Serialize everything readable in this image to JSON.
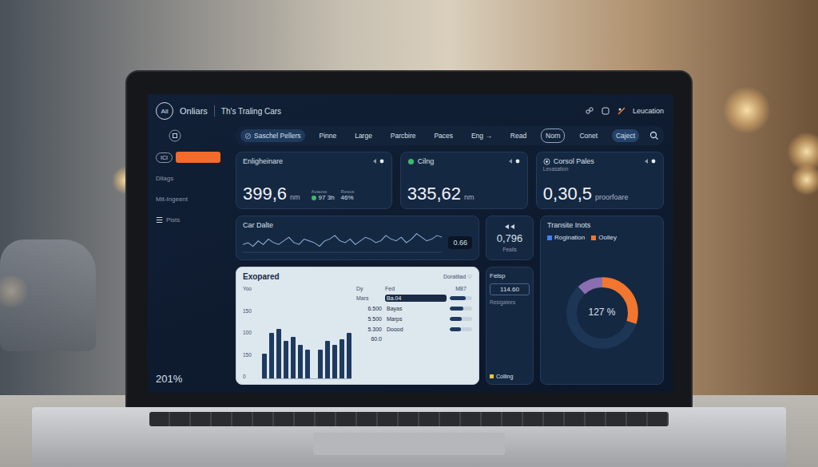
{
  "topbar": {
    "logo": "All",
    "app": "Onliars",
    "title": "Th's Traling Cars",
    "location": "Leucation"
  },
  "sidebar": {
    "items": [
      {
        "label": "ICI",
        "icon": "",
        "selected": true
      },
      {
        "label": "Dllags",
        "icon": "",
        "selected": false
      },
      {
        "label": "Mit-Ingeent",
        "icon": "",
        "selected": false
      },
      {
        "label": "Pists",
        "icon": "☰",
        "selected": false
      }
    ],
    "footer": "201%"
  },
  "filters": [
    {
      "label": "Saschel Pellers",
      "kind": "chip",
      "selected": true
    },
    {
      "label": "Pinne",
      "kind": "plain",
      "selected": false
    },
    {
      "label": "Large",
      "kind": "plain",
      "selected": false
    },
    {
      "label": "Parcbire",
      "kind": "plain",
      "selected": false
    },
    {
      "label": "Paces",
      "kind": "plain",
      "selected": false
    },
    {
      "label": "Eng →",
      "kind": "plain",
      "selected": false
    },
    {
      "label": "Read",
      "kind": "plain",
      "selected": false
    },
    {
      "label": "Norn",
      "kind": "outline",
      "selected": false
    },
    {
      "label": "Conet",
      "kind": "plain",
      "selected": false
    },
    {
      "label": "Caject",
      "kind": "filled",
      "selected": false
    }
  ],
  "cards": [
    {
      "title": "Enligheinare",
      "sub": "",
      "value": "399,6",
      "unit": "nm",
      "stats": [
        {
          "label": "Avaoss",
          "value": "97 3h",
          "kind": "dot"
        },
        {
          "label": "Resos",
          "value": "46%",
          "kind": "plain"
        }
      ]
    },
    {
      "title": "Cilng",
      "sub": "",
      "value": "335,62",
      "unit": "nm",
      "stats": []
    },
    {
      "title": "Corsol Pales",
      "sub": "Levasation",
      "value": "0,30,5",
      "unit": "proorfoare",
      "stats": []
    }
  ],
  "trend": {
    "title": "Car Dalte",
    "badge": "0.66",
    "values": [
      4,
      5,
      3,
      6,
      4,
      7,
      5,
      4,
      6,
      8,
      5,
      4,
      7,
      6,
      5,
      3,
      6,
      7,
      9,
      6,
      5,
      7,
      4,
      6,
      8,
      7,
      5,
      6,
      9,
      7,
      6,
      8,
      5,
      7,
      10,
      8,
      6,
      7,
      9,
      8
    ]
  },
  "mini": {
    "value": "0,796",
    "label": "Pealls"
  },
  "breakdown": {
    "title": "Transite Inots",
    "legend": [
      {
        "label": "Rogination",
        "color": "#3b82f6"
      },
      {
        "label": "Oolley",
        "color": "#f2762e"
      }
    ],
    "center": "127 %",
    "segments": [
      {
        "level": 0.3,
        "color": "#f2762e"
      },
      {
        "level": 0.58,
        "color": "#1d3656"
      },
      {
        "level": 0.12,
        "color": "#8a6fb0"
      }
    ]
  },
  "expanded": {
    "title": "Exopared",
    "action": "Doratliad ♡",
    "axis_label": "Yoo",
    "ticks": [
      "150",
      "100",
      "150",
      "0"
    ],
    "series": [
      {
        "values": [
          60,
          110,
          120,
          90,
          100,
          80,
          70
        ]
      },
      {
        "values": [
          70,
          90,
          80,
          95,
          110
        ]
      }
    ],
    "columns": [
      "Dy",
      "Fed",
      "M87",
      "Mars"
    ],
    "rows": [
      {
        "label": "Ba.04",
        "selected": true,
        "level": 0.7,
        "value": "6.500"
      },
      {
        "label": "Bayas",
        "selected": false,
        "level": 0.6,
        "value": "5.500"
      },
      {
        "label": "Marps",
        "selected": false,
        "level": 0.55,
        "value": "5.300"
      },
      {
        "label": "Doood",
        "selected": false,
        "level": 0.5,
        "value": "60.0"
      }
    ]
  },
  "legend_card": {
    "title": "Felsp",
    "value": "114.60",
    "label": "Resigalees",
    "legend": "Colling"
  }
}
